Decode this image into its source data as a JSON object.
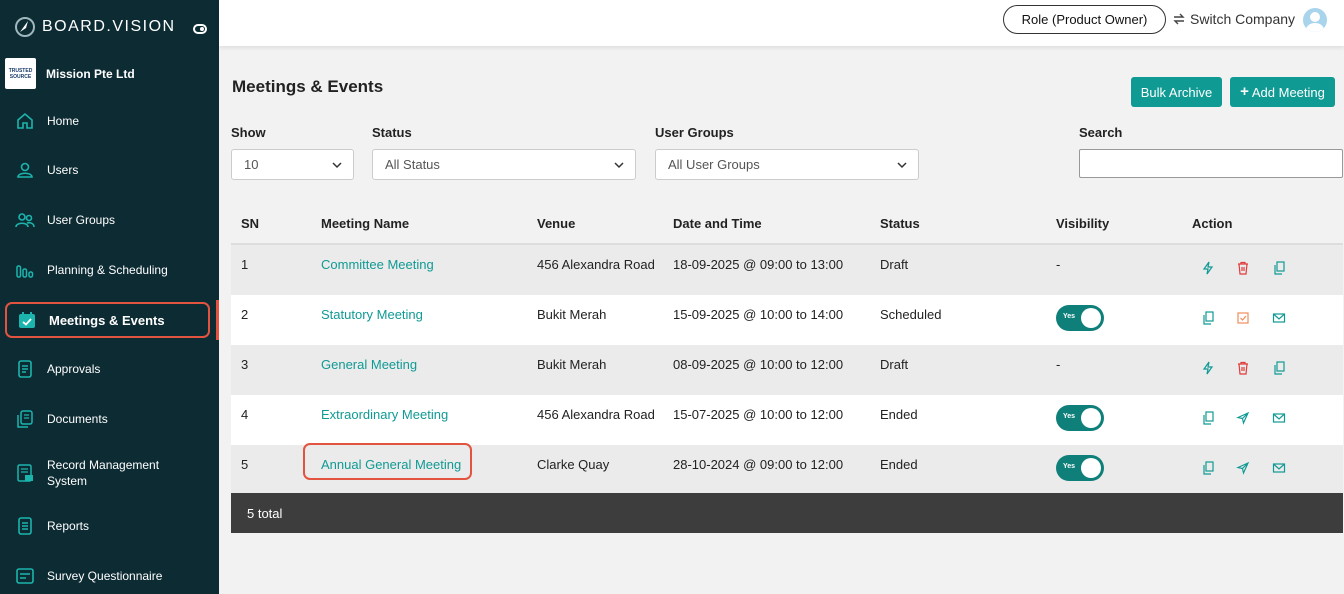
{
  "brand": {
    "name": "BOARD.VISION"
  },
  "company": {
    "logo_top": "TRUSTED",
    "logo_bottom": "SOURCE",
    "name": "Mission Pte Ltd"
  },
  "sidebar": {
    "items": [
      {
        "label": "Home",
        "icon": "home-icon"
      },
      {
        "label": "Users",
        "icon": "user-icon"
      },
      {
        "label": "User Groups",
        "icon": "users-icon"
      },
      {
        "label": "Planning & Scheduling",
        "icon": "chart-icon"
      },
      {
        "label": "Meetings & Events",
        "icon": "calendar-check-icon",
        "active": true
      },
      {
        "label": "Approvals",
        "icon": "document-icon"
      },
      {
        "label": "Documents",
        "icon": "documents-icon"
      },
      {
        "label": "Record Management System",
        "icon": "record-icon"
      },
      {
        "label": "Reports",
        "icon": "report-icon"
      },
      {
        "label": "Survey Questionnaire",
        "icon": "survey-icon"
      }
    ]
  },
  "topbar": {
    "role_label": "Role (Product Owner)",
    "switch_label": "Switch Company"
  },
  "page": {
    "title": "Meetings & Events",
    "bulk_archive": "Bulk Archive",
    "add_meeting": "Add Meeting"
  },
  "filters": {
    "show_label": "Show",
    "show_value": "10",
    "status_label": "Status",
    "status_value": "All Status",
    "groups_label": "User Groups",
    "groups_value": "All User Groups",
    "search_label": "Search",
    "search_value": ""
  },
  "table": {
    "headers": [
      "SN",
      "Meeting Name",
      "Venue",
      "Date and Time",
      "Status",
      "Visibility",
      "Action"
    ],
    "rows": [
      {
        "sn": "1",
        "name": "Committee Meeting",
        "venue": "456 Alexandra Road",
        "datetime": "18-09-2025 @ 09:00 to 13:00",
        "status": "Draft",
        "visibility": "-",
        "actions": [
          "bolt-icon",
          "trash-icon",
          "copy-icon"
        ]
      },
      {
        "sn": "2",
        "name": "Statutory Meeting",
        "venue": "Bukit Merah",
        "datetime": "15-09-2025 @ 10:00 to 14:00",
        "status": "Scheduled",
        "visibility": "Yes",
        "actions": [
          "copy-icon",
          "edit-check-icon",
          "mail-icon"
        ]
      },
      {
        "sn": "3",
        "name": "General Meeting",
        "venue": "Bukit Merah",
        "datetime": "08-09-2025 @ 10:00 to 12:00",
        "status": "Draft",
        "visibility": "-",
        "actions": [
          "bolt-icon",
          "trash-icon",
          "copy-icon"
        ]
      },
      {
        "sn": "4",
        "name": "Extraordinary Meeting",
        "venue": "456 Alexandra Road",
        "datetime": "15-07-2025 @ 10:00 to 12:00",
        "status": "Ended",
        "visibility": "Yes",
        "actions": [
          "copy-icon",
          "send-icon",
          "mail-icon"
        ]
      },
      {
        "sn": "5",
        "name": "Annual General Meeting",
        "venue": "Clarke Quay",
        "datetime": "28-10-2024 @ 09:00 to 12:00",
        "status": "Ended",
        "visibility": "Yes",
        "actions": [
          "copy-icon",
          "send-icon",
          "mail-icon"
        ]
      }
    ],
    "footer": "5 total"
  },
  "colors": {
    "accent": "#109a94",
    "sidebar": "#0d2b33",
    "highlight": "#e2543f",
    "danger": "#e03a3a",
    "warning": "#f08c5a"
  }
}
